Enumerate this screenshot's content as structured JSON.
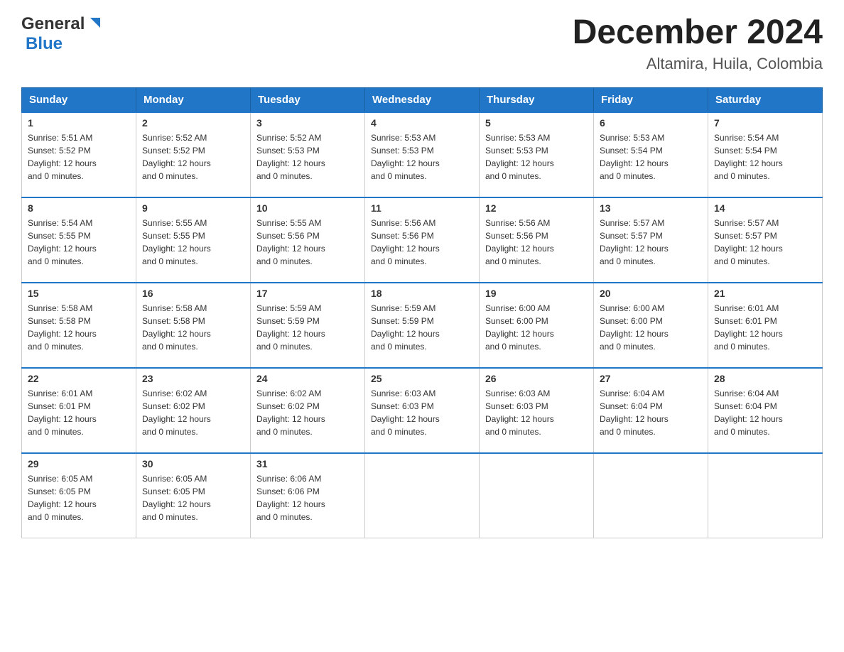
{
  "header": {
    "logo_general": "General",
    "logo_blue": "Blue",
    "month_title": "December 2024",
    "location": "Altamira, Huila, Colombia"
  },
  "calendar": {
    "weekdays": [
      "Sunday",
      "Monday",
      "Tuesday",
      "Wednesday",
      "Thursday",
      "Friday",
      "Saturday"
    ],
    "weeks": [
      [
        {
          "day": "1",
          "sunrise": "5:51 AM",
          "sunset": "5:52 PM",
          "daylight": "12 hours and 0 minutes."
        },
        {
          "day": "2",
          "sunrise": "5:52 AM",
          "sunset": "5:52 PM",
          "daylight": "12 hours and 0 minutes."
        },
        {
          "day": "3",
          "sunrise": "5:52 AM",
          "sunset": "5:53 PM",
          "daylight": "12 hours and 0 minutes."
        },
        {
          "day": "4",
          "sunrise": "5:53 AM",
          "sunset": "5:53 PM",
          "daylight": "12 hours and 0 minutes."
        },
        {
          "day": "5",
          "sunrise": "5:53 AM",
          "sunset": "5:53 PM",
          "daylight": "12 hours and 0 minutes."
        },
        {
          "day": "6",
          "sunrise": "5:53 AM",
          "sunset": "5:54 PM",
          "daylight": "12 hours and 0 minutes."
        },
        {
          "day": "7",
          "sunrise": "5:54 AM",
          "sunset": "5:54 PM",
          "daylight": "12 hours and 0 minutes."
        }
      ],
      [
        {
          "day": "8",
          "sunrise": "5:54 AM",
          "sunset": "5:55 PM",
          "daylight": "12 hours and 0 minutes."
        },
        {
          "day": "9",
          "sunrise": "5:55 AM",
          "sunset": "5:55 PM",
          "daylight": "12 hours and 0 minutes."
        },
        {
          "day": "10",
          "sunrise": "5:55 AM",
          "sunset": "5:56 PM",
          "daylight": "12 hours and 0 minutes."
        },
        {
          "day": "11",
          "sunrise": "5:56 AM",
          "sunset": "5:56 PM",
          "daylight": "12 hours and 0 minutes."
        },
        {
          "day": "12",
          "sunrise": "5:56 AM",
          "sunset": "5:56 PM",
          "daylight": "12 hours and 0 minutes."
        },
        {
          "day": "13",
          "sunrise": "5:57 AM",
          "sunset": "5:57 PM",
          "daylight": "12 hours and 0 minutes."
        },
        {
          "day": "14",
          "sunrise": "5:57 AM",
          "sunset": "5:57 PM",
          "daylight": "12 hours and 0 minutes."
        }
      ],
      [
        {
          "day": "15",
          "sunrise": "5:58 AM",
          "sunset": "5:58 PM",
          "daylight": "12 hours and 0 minutes."
        },
        {
          "day": "16",
          "sunrise": "5:58 AM",
          "sunset": "5:58 PM",
          "daylight": "12 hours and 0 minutes."
        },
        {
          "day": "17",
          "sunrise": "5:59 AM",
          "sunset": "5:59 PM",
          "daylight": "12 hours and 0 minutes."
        },
        {
          "day": "18",
          "sunrise": "5:59 AM",
          "sunset": "5:59 PM",
          "daylight": "12 hours and 0 minutes."
        },
        {
          "day": "19",
          "sunrise": "6:00 AM",
          "sunset": "6:00 PM",
          "daylight": "12 hours and 0 minutes."
        },
        {
          "day": "20",
          "sunrise": "6:00 AM",
          "sunset": "6:00 PM",
          "daylight": "12 hours and 0 minutes."
        },
        {
          "day": "21",
          "sunrise": "6:01 AM",
          "sunset": "6:01 PM",
          "daylight": "12 hours and 0 minutes."
        }
      ],
      [
        {
          "day": "22",
          "sunrise": "6:01 AM",
          "sunset": "6:01 PM",
          "daylight": "12 hours and 0 minutes."
        },
        {
          "day": "23",
          "sunrise": "6:02 AM",
          "sunset": "6:02 PM",
          "daylight": "12 hours and 0 minutes."
        },
        {
          "day": "24",
          "sunrise": "6:02 AM",
          "sunset": "6:02 PM",
          "daylight": "12 hours and 0 minutes."
        },
        {
          "day": "25",
          "sunrise": "6:03 AM",
          "sunset": "6:03 PM",
          "daylight": "12 hours and 0 minutes."
        },
        {
          "day": "26",
          "sunrise": "6:03 AM",
          "sunset": "6:03 PM",
          "daylight": "12 hours and 0 minutes."
        },
        {
          "day": "27",
          "sunrise": "6:04 AM",
          "sunset": "6:04 PM",
          "daylight": "12 hours and 0 minutes."
        },
        {
          "day": "28",
          "sunrise": "6:04 AM",
          "sunset": "6:04 PM",
          "daylight": "12 hours and 0 minutes."
        }
      ],
      [
        {
          "day": "29",
          "sunrise": "6:05 AM",
          "sunset": "6:05 PM",
          "daylight": "12 hours and 0 minutes."
        },
        {
          "day": "30",
          "sunrise": "6:05 AM",
          "sunset": "6:05 PM",
          "daylight": "12 hours and 0 minutes."
        },
        {
          "day": "31",
          "sunrise": "6:06 AM",
          "sunset": "6:06 PM",
          "daylight": "12 hours and 0 minutes."
        },
        null,
        null,
        null,
        null
      ]
    ]
  }
}
